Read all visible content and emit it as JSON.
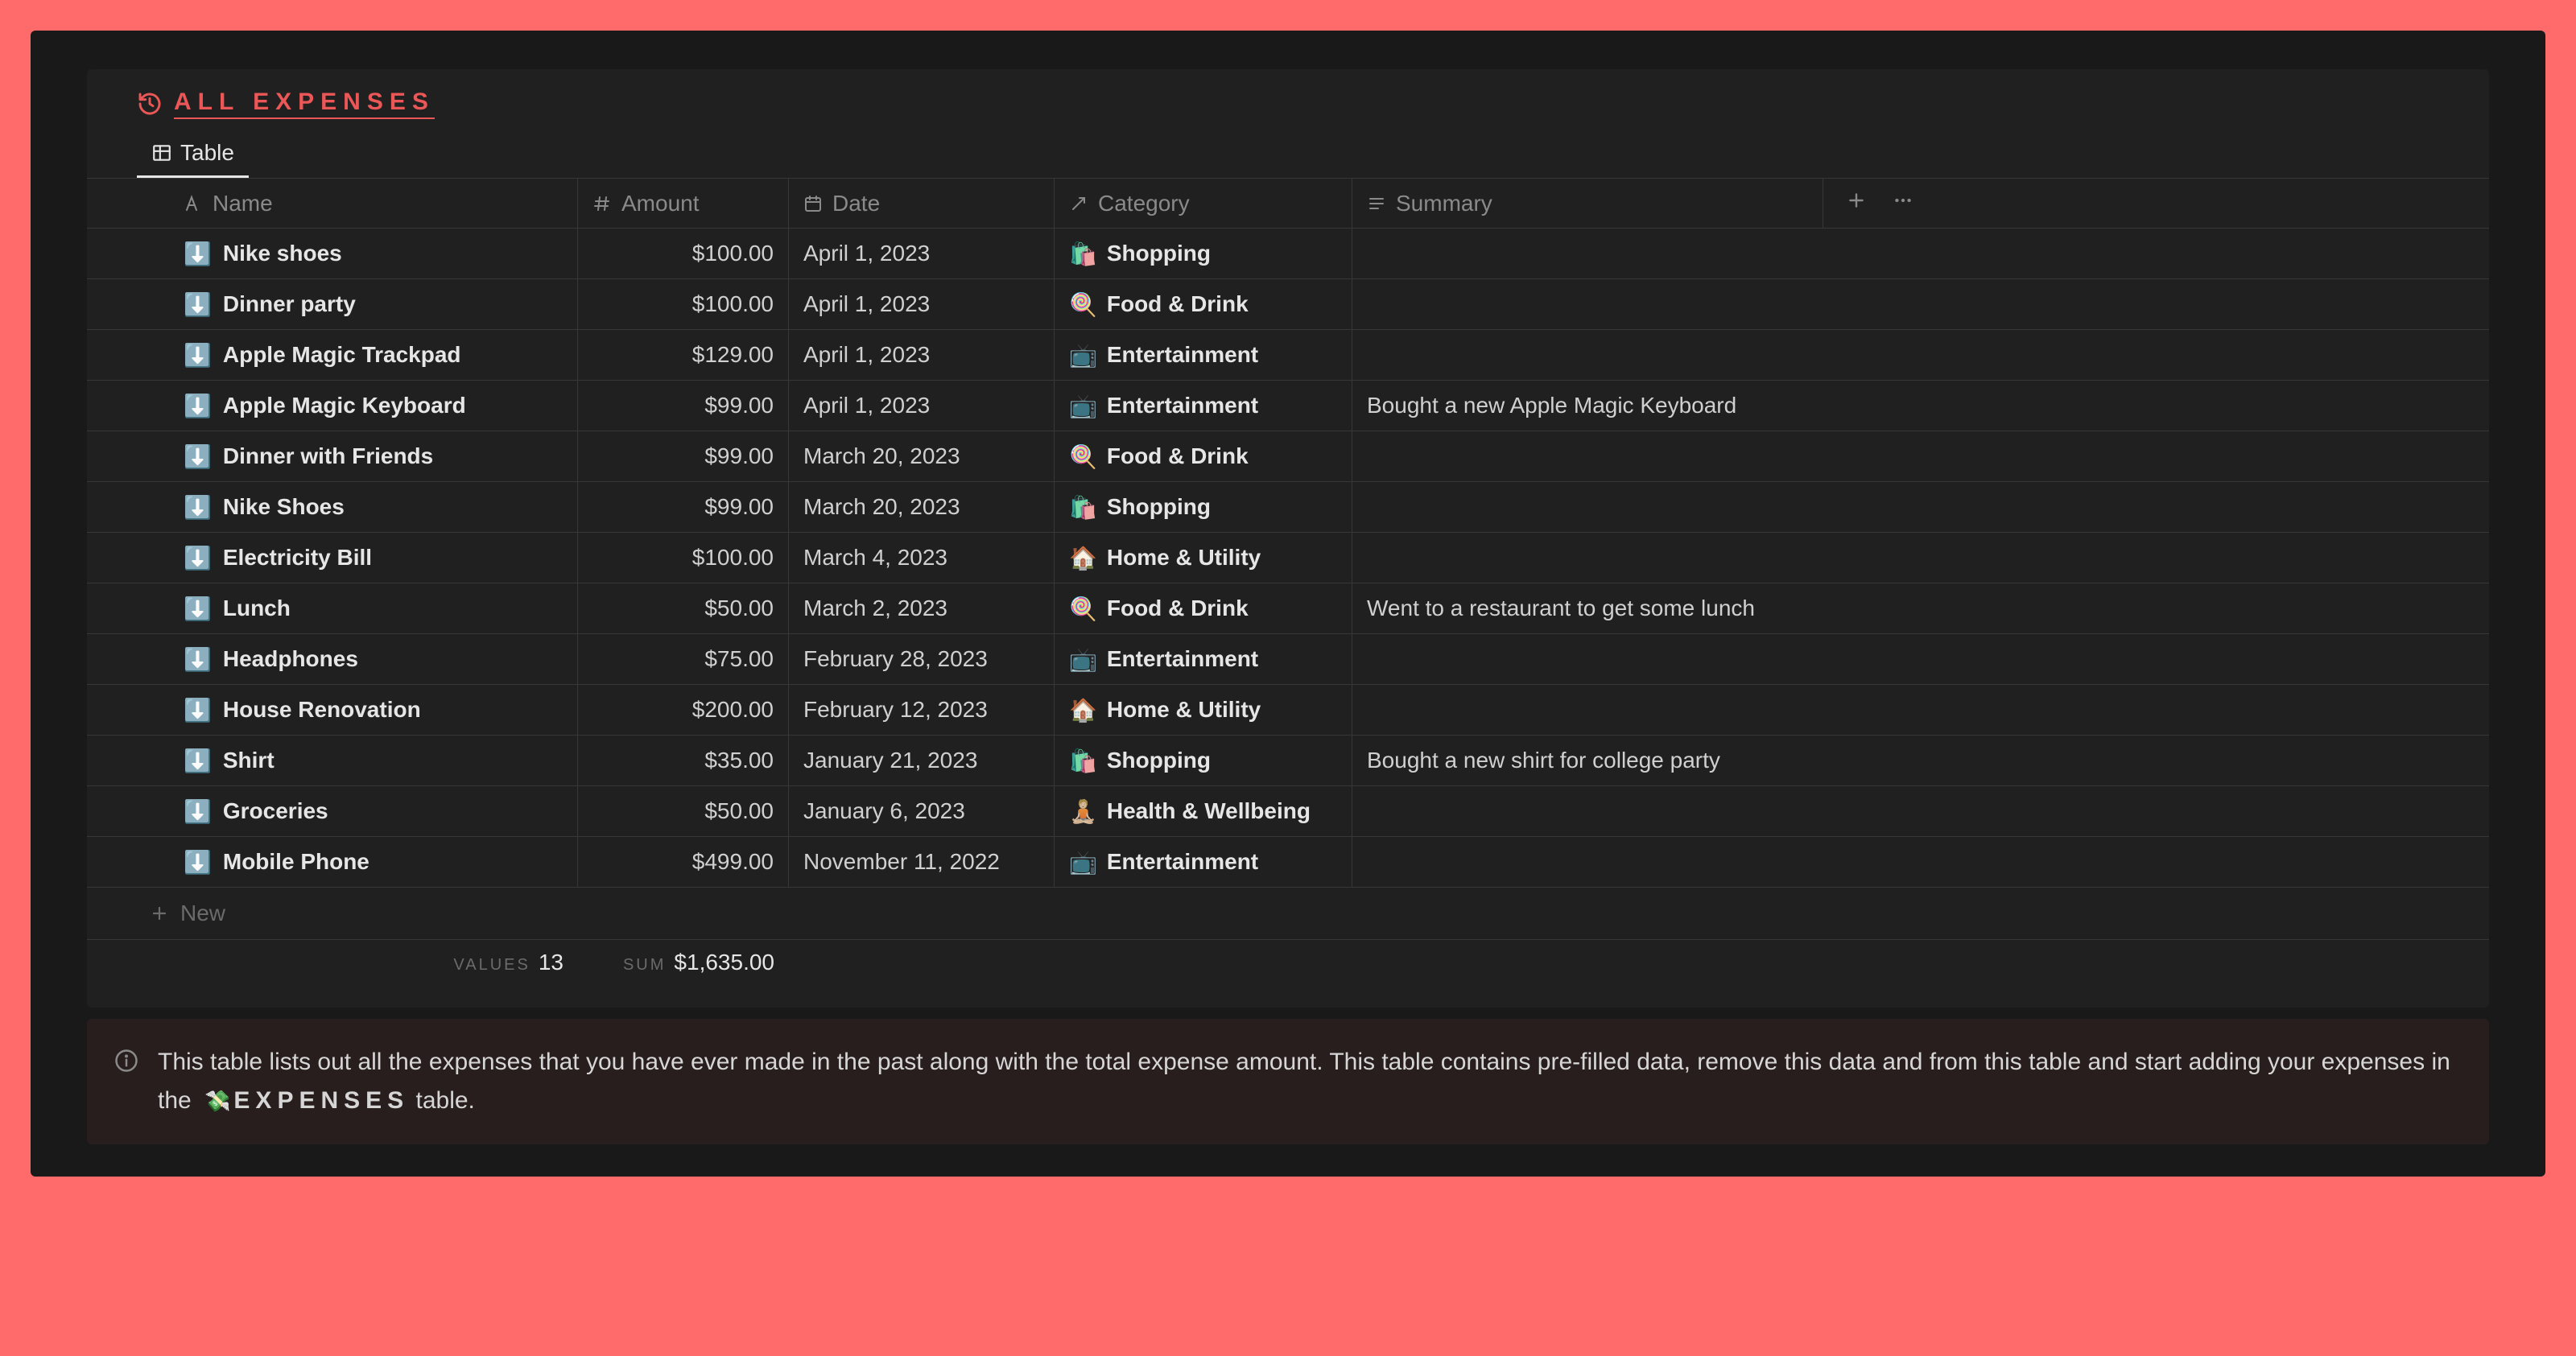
{
  "page_title": "ALL EXPENSES",
  "tab_label": "Table",
  "columns": {
    "name": "Name",
    "amount": "Amount",
    "date": "Date",
    "category": "Category",
    "summary": "Summary"
  },
  "categories": {
    "shopping": {
      "label": "Shopping",
      "emoji": "🛍️"
    },
    "food": {
      "label": "Food & Drink",
      "emoji": "🍭"
    },
    "ent": {
      "label": "Entertainment",
      "emoji": "📺"
    },
    "home": {
      "label": "Home & Utility",
      "emoji": "🏠"
    },
    "health": {
      "label": "Health & Wellbeing",
      "emoji": "🧘🏼"
    }
  },
  "rows": [
    {
      "name": "Nike shoes",
      "amount": "$100.00",
      "date": "April 1, 2023",
      "cat": "shopping",
      "summary": ""
    },
    {
      "name": "Dinner party",
      "amount": "$100.00",
      "date": "April 1, 2023",
      "cat": "food",
      "summary": ""
    },
    {
      "name": "Apple Magic Trackpad",
      "amount": "$129.00",
      "date": "April 1, 2023",
      "cat": "ent",
      "summary": ""
    },
    {
      "name": "Apple Magic Keyboard",
      "amount": "$99.00",
      "date": "April 1, 2023",
      "cat": "ent",
      "summary": "Bought a new Apple Magic Keyboard"
    },
    {
      "name": "Dinner with Friends",
      "amount": "$99.00",
      "date": "March 20, 2023",
      "cat": "food",
      "summary": ""
    },
    {
      "name": "Nike Shoes",
      "amount": "$99.00",
      "date": "March 20, 2023",
      "cat": "shopping",
      "summary": ""
    },
    {
      "name": "Electricity Bill",
      "amount": "$100.00",
      "date": "March 4, 2023",
      "cat": "home",
      "summary": ""
    },
    {
      "name": "Lunch",
      "amount": "$50.00",
      "date": "March 2, 2023",
      "cat": "food",
      "summary": "Went to a restaurant to get some lunch"
    },
    {
      "name": "Headphones",
      "amount": "$75.00",
      "date": "February 28, 2023",
      "cat": "ent",
      "summary": ""
    },
    {
      "name": "House Renovation",
      "amount": "$200.00",
      "date": "February 12, 2023",
      "cat": "home",
      "summary": ""
    },
    {
      "name": "Shirt",
      "amount": "$35.00",
      "date": "January 21, 2023",
      "cat": "shopping",
      "summary": "Bought a new shirt for college party"
    },
    {
      "name": "Groceries",
      "amount": "$50.00",
      "date": "January 6, 2023",
      "cat": "health",
      "summary": ""
    },
    {
      "name": "Mobile Phone",
      "amount": "$499.00",
      "date": "November 11, 2022",
      "cat": "ent",
      "summary": ""
    }
  ],
  "new_label": "New",
  "footer": {
    "values_label": "VALUES",
    "values_count": "13",
    "sum_label": "SUM",
    "sum_value": "$1,635.00"
  },
  "callout": {
    "text_before": "This table lists out all the expenses that you have ever made in the past along with the total expense amount. This table contains pre-filled data, remove this data and from this table and start adding your expenses in the ",
    "link_label": "EXPENSES",
    "text_after": " table."
  }
}
